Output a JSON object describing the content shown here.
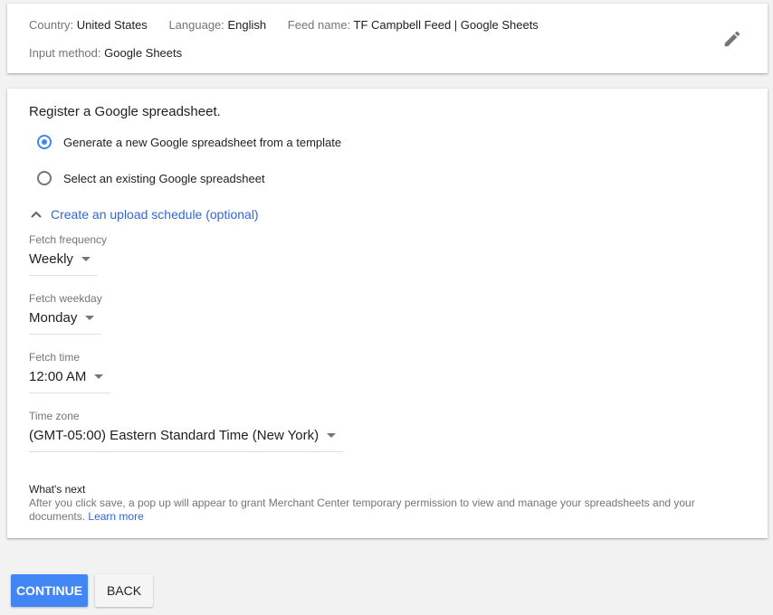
{
  "summary": {
    "country_label": "Country:",
    "country_value": "United States",
    "language_label": "Language:",
    "language_value": "English",
    "feed_name_label": "Feed name:",
    "feed_name_value": "TF Campbell Feed | Google Sheets",
    "input_method_label": "Input method:",
    "input_method_value": "Google Sheets",
    "edit_icon": "pencil-icon"
  },
  "register": {
    "title": "Register a Google spreadsheet.",
    "options": [
      {
        "label": "Generate a new Google spreadsheet from a template",
        "selected": true
      },
      {
        "label": "Select an existing Google spreadsheet",
        "selected": false
      }
    ],
    "schedule_toggle": "Create an upload schedule (optional)",
    "schedule_expanded": true
  },
  "schedule": {
    "fetch_frequency": {
      "label": "Fetch frequency",
      "value": "Weekly"
    },
    "fetch_weekday": {
      "label": "Fetch weekday",
      "value": "Monday"
    },
    "fetch_time": {
      "label": "Fetch time",
      "value": "12:00 AM"
    },
    "time_zone": {
      "label": "Time zone",
      "value": "(GMT-05:00) Eastern Standard Time (New York)"
    }
  },
  "whats_next": {
    "title": "What's next",
    "body": "After you click save, a pop up will appear to grant Merchant Center temporary permission to view and manage your spreadsheets and your documents.",
    "link": "Learn more"
  },
  "actions": {
    "continue": "CONTINUE",
    "back": "BACK"
  },
  "colors": {
    "accent": "#4285f4",
    "link": "#3367d6"
  }
}
